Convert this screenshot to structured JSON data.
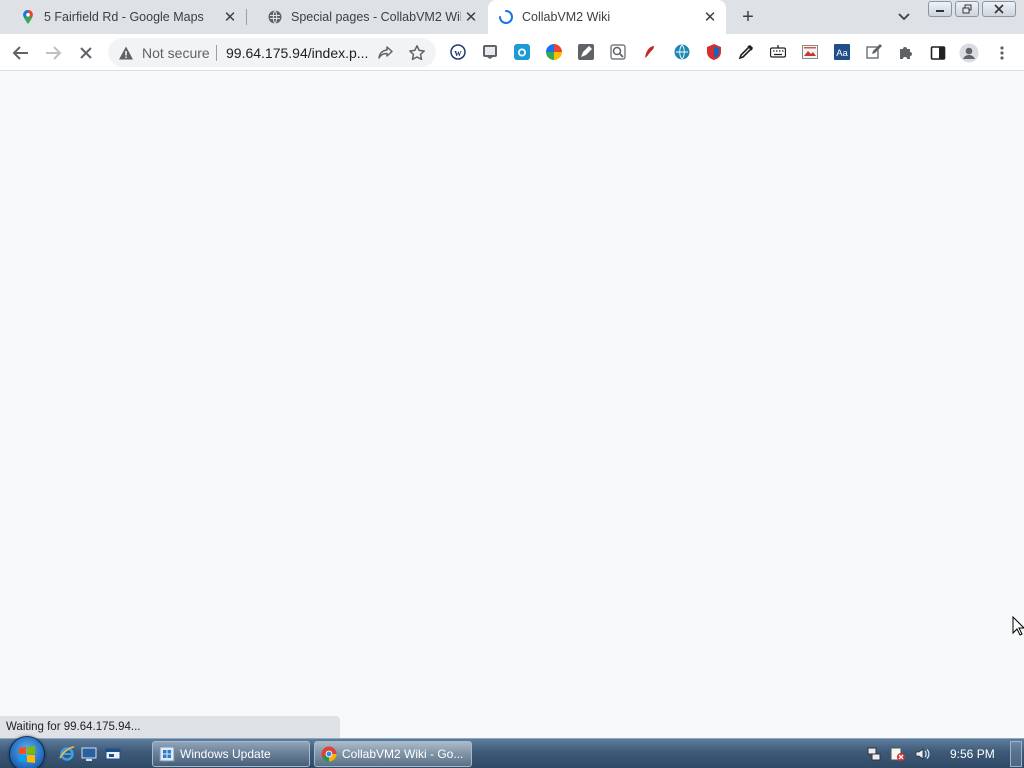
{
  "browser": {
    "tabs": [
      {
        "title": "5 Fairfield Rd - Google Maps",
        "icon": "maps-pin-icon"
      },
      {
        "title": "Special pages - CollabVM2 Wiki",
        "icon": "globe-icon"
      },
      {
        "title": "CollabVM2 Wiki",
        "icon": "loading-spinner-icon",
        "active": true
      }
    ],
    "new_tab_label": "+",
    "omnibox": {
      "security_label": "Not secure",
      "url": "99.64.175.94/index.p..."
    },
    "extensions": [
      "wikiwand-icon",
      "screenshot-icon",
      "camera-icon",
      "color-picker-icon",
      "pen-icon",
      "magnifier-icon",
      "bug-icon",
      "globe-translate-icon",
      "shield-icon",
      "pen-nib-icon",
      "keyboard-icon",
      "image-icon",
      "dictionary-icon",
      "edit-icon",
      "puzzle-icon"
    ],
    "status_text": "Waiting for 99.64.175.94..."
  },
  "colors": {
    "tabstrip": "#dee1e6",
    "page_background": "#f8f9fa",
    "taskbar": "#3d5a78",
    "loading_accent": "#1a73e8"
  },
  "taskbar": {
    "buttons": [
      {
        "label": "Windows Update",
        "icon": "windows-update-icon"
      },
      {
        "label": "CollabVM2 Wiki - Go...",
        "icon": "chrome-icon",
        "active": true
      }
    ],
    "quick_launch": [
      "ie-icon",
      "desktop-icon",
      "window-switcher-icon"
    ],
    "tray": [
      "network-icon",
      "volume-mute-flag-icon",
      "speaker-icon"
    ],
    "clock": "9:56 PM"
  }
}
